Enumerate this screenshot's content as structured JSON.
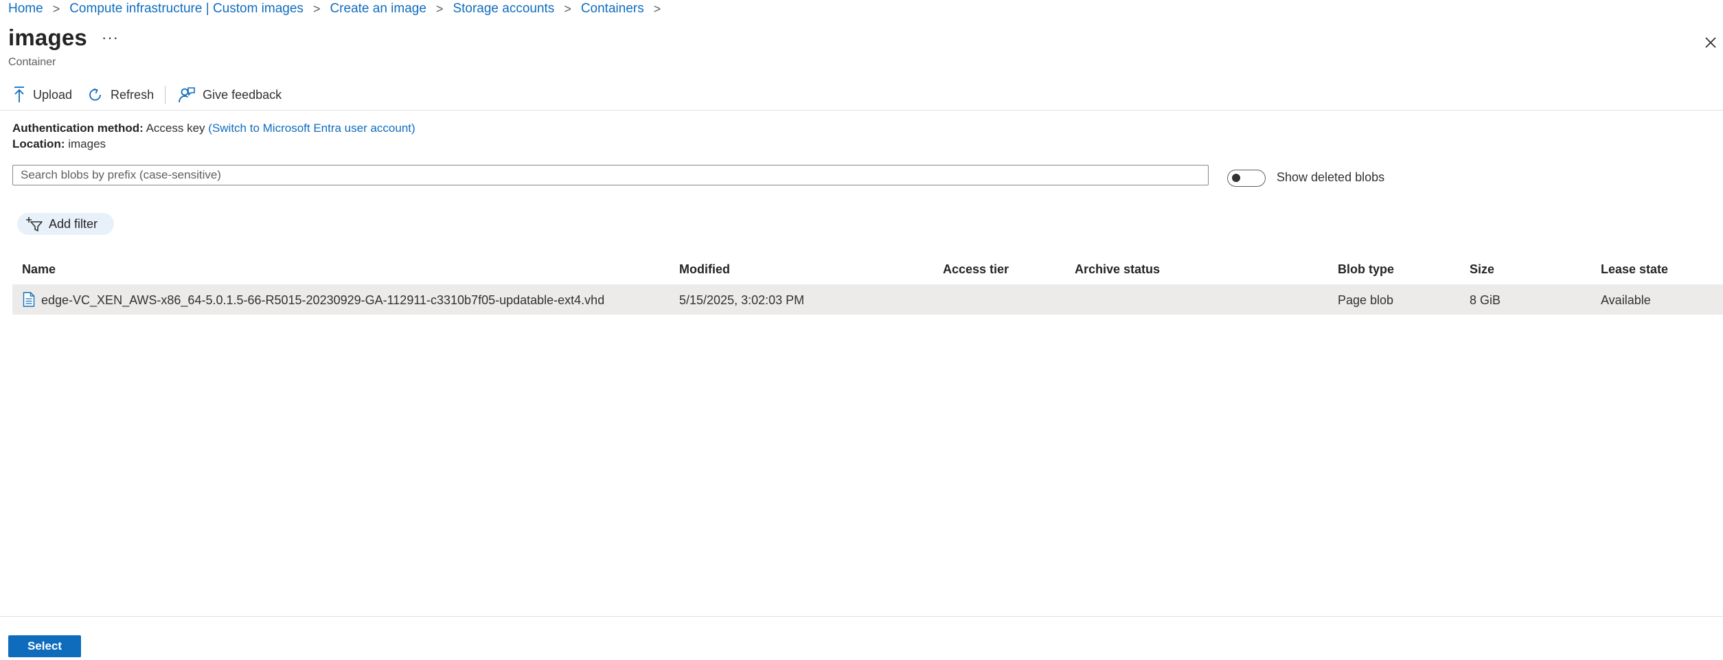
{
  "breadcrumb": [
    {
      "label": "Home"
    },
    {
      "label": "Compute infrastructure | Custom images"
    },
    {
      "label": "Create an image"
    },
    {
      "label": "Storage accounts"
    },
    {
      "label": "Containers"
    }
  ],
  "header": {
    "title": "images",
    "more_label": "···",
    "subtitle": "Container"
  },
  "toolbar": {
    "upload_label": "Upload",
    "refresh_label": "Refresh",
    "feedback_label": "Give feedback"
  },
  "info": {
    "auth_label": "Authentication method:",
    "auth_value": "Access key",
    "auth_switch_link": "(Switch to Microsoft Entra user account)",
    "location_label": "Location:",
    "location_value": "images"
  },
  "search": {
    "placeholder": "Search blobs by prefix (case-sensitive)"
  },
  "show_deleted": {
    "label": "Show deleted blobs",
    "enabled": false
  },
  "filter": {
    "add_filter_label": "Add filter"
  },
  "table": {
    "columns": [
      "Name",
      "Modified",
      "Access tier",
      "Archive status",
      "Blob type",
      "Size",
      "Lease state"
    ],
    "rows": [
      {
        "name": "edge-VC_XEN_AWS-x86_64-5.0.1.5-66-R5015-20230929-GA-112911-c3310b7f05-updatable-ext4.vhd",
        "modified": "5/15/2025, 3:02:03 PM",
        "access_tier": "",
        "archive_status": "",
        "blob_type": "Page blob",
        "size": "8 GiB",
        "lease_state": "Available"
      }
    ]
  },
  "footer": {
    "select_label": "Select"
  },
  "colors": {
    "accent": "#0f6cbd",
    "row_selected": "#edebe9",
    "filter_pill": "#e8f1f9"
  }
}
